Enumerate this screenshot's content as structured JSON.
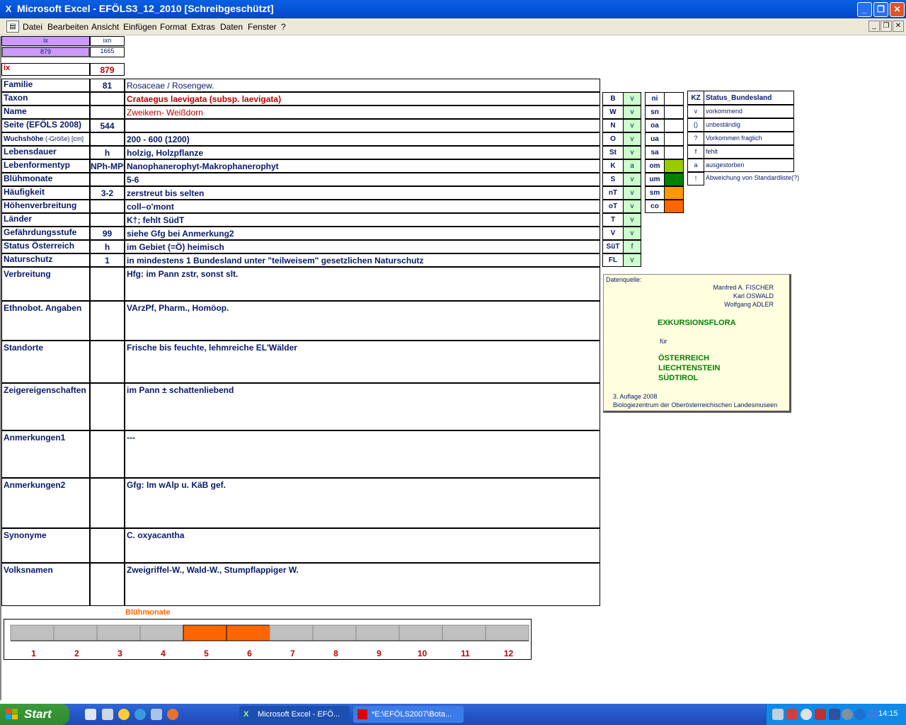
{
  "window": {
    "title": "Microsoft Excel - EFÖLS3_12_2010  [Schreibgeschützt]"
  },
  "menu": [
    "Datei",
    "Bearbeiten",
    "Ansicht",
    "Einfügen",
    "Format",
    "Extras",
    "Daten",
    "Fenster",
    "?"
  ],
  "top_index": {
    "h1": "ix",
    "h2": "ixn",
    "v1": "879",
    "v2": "1665",
    "ix_label": "ix",
    "ix_value": "879"
  },
  "rows": [
    {
      "label": "Familie",
      "code": "81",
      "value": "Rosaceae  /  Rosengew."
    },
    {
      "label": "Taxon",
      "code": "",
      "value": "Crataegus laevigata (subsp. laevigata)"
    },
    {
      "label": "Name",
      "code": "",
      "value": "Zweikern- Weißdorn"
    },
    {
      "label": "Seite (EFÖLS 2008)",
      "code": "544",
      "value": ""
    },
    {
      "label": "Wuchshöhe",
      "label_small": " (-Größe) [cm]",
      "code": "",
      "value": " 200 - 600 (1200)"
    },
    {
      "label": "Lebensdauer",
      "code": "h",
      "value": "holzig, Holzpflanze"
    },
    {
      "label": "Lebenformentyp",
      "code": "NPh-MPh",
      "value": "Nanophanerophyt-Makrophanerophyt"
    },
    {
      "label": "Blühmonate",
      "code": "",
      "value": " 5-6"
    },
    {
      "label": "Häufigkeit",
      "code": "3-2",
      "value": "zerstreut bis selten"
    },
    {
      "label": "Höhenverbreitung",
      "code": "",
      "value": "coll–o'mont"
    },
    {
      "label": "Länder",
      "code": "",
      "value": " K†; fehlt SüdT"
    },
    {
      "label": "Gefährdungsstufe",
      "code": "99",
      "value": "siehe Gfg bei Anmerkung2"
    },
    {
      "label": "Status Österreich",
      "code": "h",
      "value": "im Gebiet (=Ö) heimisch"
    },
    {
      "label": "Naturschutz",
      "code": "1",
      "value": "in mindestens 1 Bundesland unter \"teilweisem\" gesetzlichen Naturschutz"
    }
  ],
  "big_rows": [
    {
      "label": "Verbreitung",
      "value": "Hfg:  im Pann zstr, sonst slt."
    },
    {
      "label": "Ethnobot. Angaben",
      "value": " VArzPf, Pharm., Homöop."
    },
    {
      "label": "Standorte",
      "value": "Frische bis feuchte, lehmreiche EL'Wälder"
    },
    {
      "label": "Zeigereigenschaften",
      "value": "im Pann ± schattenliebend"
    },
    {
      "label": "Anmerkungen1",
      "value": "---"
    },
    {
      "label": "Anmerkungen2",
      "value": "Gfg: Im wAlp u. KäB gef."
    },
    {
      "label": "Synonyme",
      "value": "C. oxyacantha"
    },
    {
      "label": "Volksnamen",
      "value": "Zweigriffel-W., Wald-W.,   Stumpflappiger W."
    }
  ],
  "states": [
    {
      "code": "B",
      "val": "v"
    },
    {
      "code": "W",
      "val": "v"
    },
    {
      "code": "N",
      "val": "v"
    },
    {
      "code": "O",
      "val": "v"
    },
    {
      "code": "St",
      "val": "v"
    },
    {
      "code": "K",
      "val": "a"
    },
    {
      "code": "S",
      "val": "v"
    },
    {
      "code": "nT",
      "val": "v"
    },
    {
      "code": "oT",
      "val": "v"
    },
    {
      "code": "T",
      "val": "v"
    },
    {
      "code": "V",
      "val": "v"
    },
    {
      "code": "SüT",
      "val": "f"
    },
    {
      "code": "FL",
      "val": "v"
    }
  ],
  "altitude": [
    {
      "code": "ni",
      "color": ""
    },
    {
      "code": "sn",
      "color": ""
    },
    {
      "code": "oa",
      "color": ""
    },
    {
      "code": "ua",
      "color": ""
    },
    {
      "code": "sa",
      "color": ""
    },
    {
      "code": "om",
      "color": "#99cc00"
    },
    {
      "code": "um",
      "color": "#008000"
    },
    {
      "code": "sm",
      "color": "#ff9900"
    },
    {
      "code": "co",
      "color": "#ff6600"
    }
  ],
  "legend": {
    "kz": "KZ",
    "header": "Status_Bundesland",
    "items": [
      {
        "k": "v",
        "t": "vorkommend"
      },
      {
        "k": "()",
        "t": "unbeständig"
      },
      {
        "k": "?",
        "t": "Vorkommen fraglich"
      },
      {
        "k": "f",
        "t": "fehlt"
      },
      {
        "k": "a",
        "t": "ausgestorben"
      },
      {
        "k": "!",
        "t": "Abweichung von Standardliste(?)"
      }
    ]
  },
  "source": {
    "label": "Datenquelle:",
    "authors": [
      "Manfred A. FISCHER",
      "Karl OSWALD",
      "Wolfgang ADLER"
    ],
    "book": "EXKURSIONSFLORA",
    "fuer": "für",
    "countries": [
      "ÖSTERREICH",
      "LIECHTENSTEIN",
      "SÜDTIROL"
    ],
    "edition": "3. Auflage 2008",
    "publisher": "Biologiezentrum der Oberösterreichischen Landesmuseen"
  },
  "chart_data": {
    "type": "bar",
    "title": "Blühmonate",
    "categories": [
      "1",
      "2",
      "3",
      "4",
      "5",
      "6",
      "7",
      "8",
      "9",
      "10",
      "11",
      "12"
    ],
    "values": [
      0,
      0,
      0,
      0,
      1,
      1,
      0,
      0,
      0,
      0,
      0,
      0
    ],
    "colors": {
      "active": "#ff6600",
      "inactive": "#c0c0c0"
    }
  },
  "taskbar": {
    "start": "Start",
    "tasks": [
      "Microsoft Excel - EFÖ...",
      "*E:\\EFÖLS2007\\Bota..."
    ],
    "clock": "14:15"
  }
}
